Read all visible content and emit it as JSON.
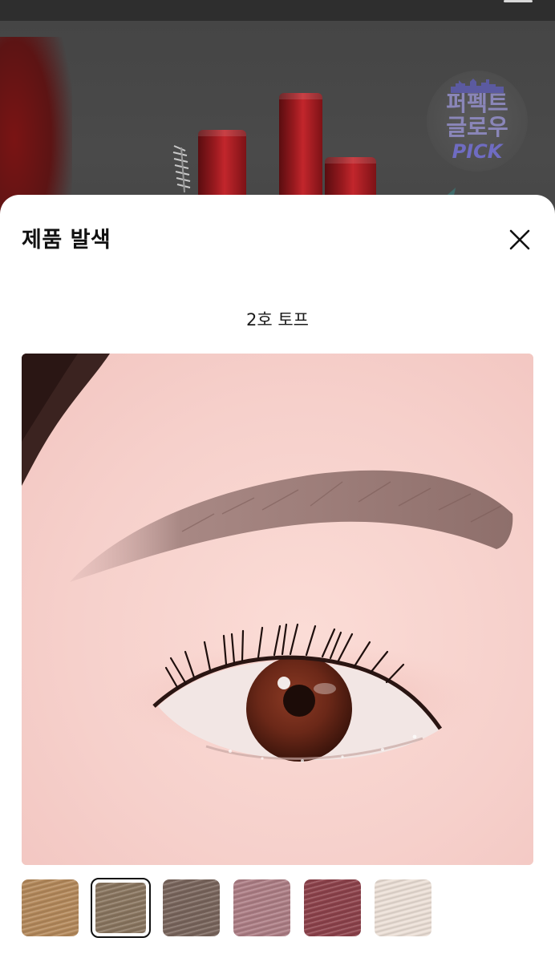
{
  "background": {
    "badge": {
      "line1": "퍼펙트",
      "line2": "글로우",
      "pick": "PICK"
    }
  },
  "sheet": {
    "title": "제품 발색",
    "close_label": "close",
    "shade_name": "2호 토프"
  },
  "shades": [
    {
      "color": "#b58a5c",
      "selected": false
    },
    {
      "color": "#8a7660",
      "selected": true
    },
    {
      "color": "#7a665d",
      "selected": false
    },
    {
      "color": "#ae7f86",
      "selected": false
    },
    {
      "color": "#8e434c",
      "selected": false
    },
    {
      "color": "#ede1d8",
      "selected": false
    }
  ],
  "colors": {
    "sheet_bg": "#ffffff",
    "overlay": "#3b3b3b",
    "accent_red": "#b01e24",
    "badge_text": "#8a86b8"
  }
}
